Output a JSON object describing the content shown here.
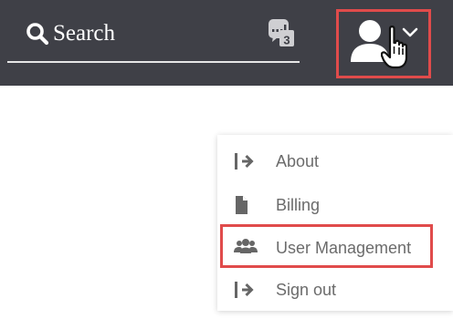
{
  "search": {
    "label": "Search",
    "icon": "search-icon"
  },
  "notifications": {
    "icon": "notifications-icon",
    "count": "3"
  },
  "user_menu": {
    "icons": [
      "user-icon",
      "pointer-hand-icon",
      "chevron-down-icon"
    ],
    "items": [
      {
        "label": "About",
        "icon": "sign-in-arrow-icon"
      },
      {
        "label": "Billing",
        "icon": "document-icon"
      },
      {
        "label": "User Management",
        "icon": "users-icon"
      },
      {
        "label": "Sign out",
        "icon": "sign-out-arrow-icon"
      }
    ]
  },
  "colors": {
    "topbar_bg": "#3f4047",
    "highlight": "#e04b4b",
    "menu_text": "#6b6b6b"
  }
}
